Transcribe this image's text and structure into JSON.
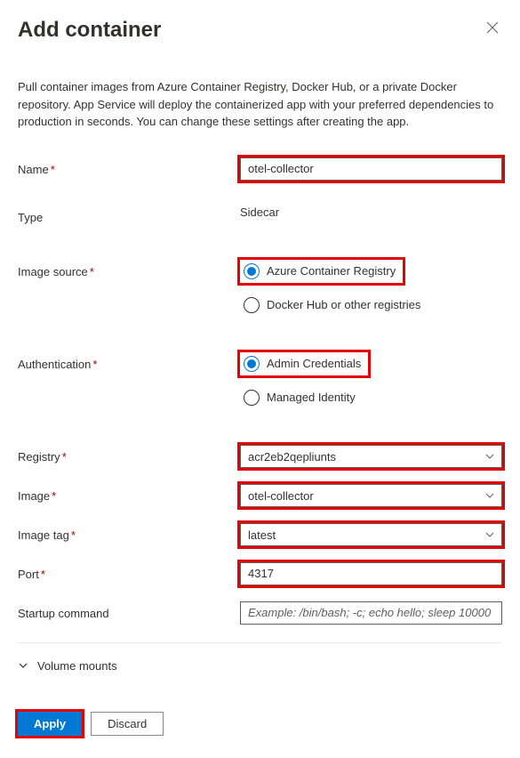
{
  "header": {
    "title": "Add container"
  },
  "description": "Pull container images from Azure Container Registry, Docker Hub, or a private Docker repository. App Service will deploy the containerized app with your preferred dependencies to production in seconds. You can change these settings after creating the app.",
  "form": {
    "name": {
      "label": "Name",
      "value": "otel-collector"
    },
    "type": {
      "label": "Type",
      "value": "Sidecar"
    },
    "imageSource": {
      "label": "Image source",
      "options": [
        {
          "label": "Azure Container Registry",
          "selected": true
        },
        {
          "label": "Docker Hub or other registries",
          "selected": false
        }
      ]
    },
    "authentication": {
      "label": "Authentication",
      "options": [
        {
          "label": "Admin Credentials",
          "selected": true
        },
        {
          "label": "Managed Identity",
          "selected": false
        }
      ]
    },
    "registry": {
      "label": "Registry",
      "value": "acr2eb2qepliunts"
    },
    "image": {
      "label": "Image",
      "value": "otel-collector"
    },
    "imageTag": {
      "label": "Image tag",
      "value": "latest"
    },
    "port": {
      "label": "Port",
      "value": "4317"
    },
    "startupCommand": {
      "label": "Startup command",
      "placeholder": "Example: /bin/bash; -c; echo hello; sleep 10000"
    }
  },
  "collapsible": {
    "volumeMounts": "Volume mounts"
  },
  "footer": {
    "apply": "Apply",
    "discard": "Discard"
  }
}
